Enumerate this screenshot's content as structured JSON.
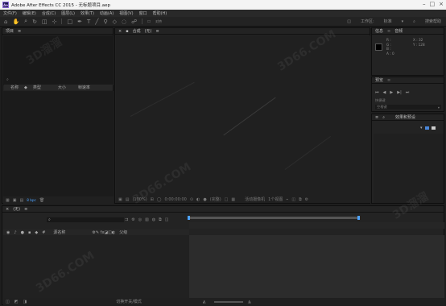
{
  "window": {
    "app_icon": "Ae",
    "title": "Adobe After Effects CC 2015 - 无标题项目.aep",
    "controls": [
      "minimize-icon",
      "maximize-icon",
      "close-icon"
    ]
  },
  "menu": [
    "文件(F)",
    "编辑(E)",
    "合成(C)",
    "图层(L)",
    "效果(T)",
    "动画(A)",
    "视图(V)",
    "窗口",
    "帮助(H)"
  ],
  "toolbar": {
    "tools": [
      "home-icon",
      "hand-icon",
      "zoom-icon",
      "rotate-icon",
      "camera-icon",
      "pan-behind-icon",
      "rect-shape-icon",
      "pen-icon",
      "text-icon",
      "brush-icon",
      "clone-icon",
      "eraser-icon",
      "roto-icon",
      "puppet-icon"
    ],
    "snapping": "对齐",
    "workspace_label": "工作区:",
    "workspace_value": "标准",
    "search_placeholder": "搜索帮助"
  },
  "project_panel": {
    "title": "项目",
    "columns": [
      "名称",
      "类型",
      "大小",
      "帧速率"
    ],
    "footer_bit_depth": "8 bpc"
  },
  "composition_panel": {
    "tab": "合成",
    "tab_value": "(无)",
    "zoom": "(100%)",
    "timecode": "0:00:00:00",
    "resolution": "(完整)",
    "camera": "活动摄像机",
    "views": "1个视图"
  },
  "info_panel": {
    "tabs": [
      "信息",
      "音频"
    ],
    "rgb": [
      "R :",
      "G :",
      "B :",
      "A : 0"
    ],
    "x": "X : 32",
    "y": "Y : 128"
  },
  "preview_panel": {
    "title": "预览",
    "shortcut_label": "快捷键",
    "shortcut_value": "空格键"
  },
  "effects_panel": {
    "title": "效果和预设",
    "search_icon": "search-icon"
  },
  "timeline_panel": {
    "tab": "(无)",
    "search_placeholder": "",
    "columns": [
      "源名称",
      "父级"
    ],
    "footer_toggle": "切换开关/模式"
  },
  "colors": {
    "accent_blue": "#4da3ff",
    "panel_bg": "#232323",
    "frame_bg": "#191919"
  }
}
